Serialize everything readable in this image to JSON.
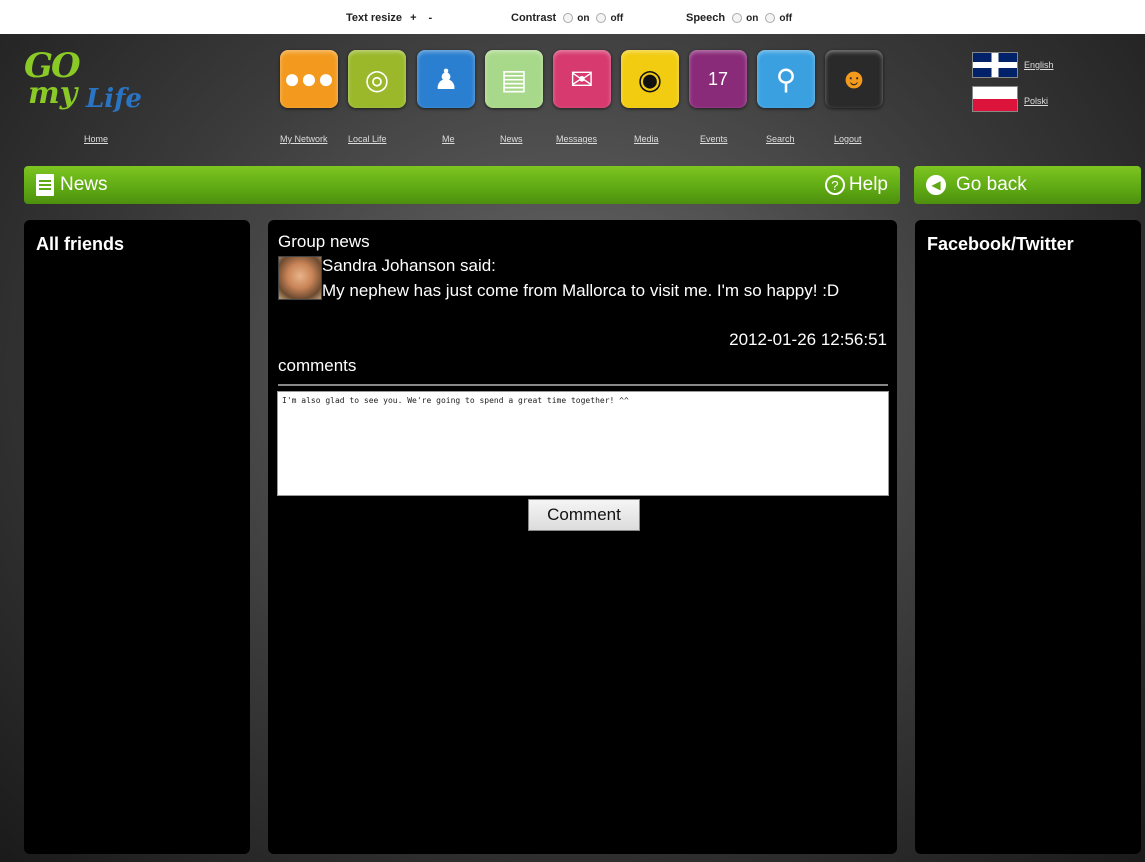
{
  "accessibility": {
    "text_resize_label": "Text resize",
    "text_increase": "+",
    "text_decrease": "-",
    "contrast_label": "Contrast",
    "speech_label": "Speech",
    "on": "on",
    "off": "off"
  },
  "header": {
    "logo_go": "GO",
    "logo_my": "my",
    "logo_life": "Life",
    "home_label": "Home",
    "nav": [
      {
        "label": "My Network",
        "icon": "network-icon",
        "color": "#f39a1e"
      },
      {
        "label": "Local Life",
        "icon": "local-life-icon",
        "color": "#9ab82a"
      },
      {
        "label": "Me",
        "icon": "user-icon",
        "color": "#2a7fd0"
      },
      {
        "label": "News",
        "icon": "news-icon",
        "color": "#a8d98a"
      },
      {
        "label": "Messages",
        "icon": "envelope-icon",
        "color": "#d63a6f"
      },
      {
        "label": "Media",
        "icon": "camera-icon",
        "color": "#f2cc10"
      },
      {
        "label": "Events",
        "icon": "calendar-icon",
        "color": "#8a2b7a"
      },
      {
        "label": "Search",
        "icon": "search-icon",
        "color": "#3aa0e0"
      },
      {
        "label": "Logout",
        "icon": "logout-icon",
        "color": "#2a2a2a"
      }
    ],
    "languages": [
      "English",
      "Polski"
    ]
  },
  "news_bar": {
    "title": "News",
    "help": "Help",
    "go_back": "Go back"
  },
  "left_panel": {
    "title": "All friends"
  },
  "right_panel": {
    "title": "Facebook/Twitter"
  },
  "center_panel": {
    "group_news": "Group news",
    "author_said": "Sandra Johanson said:",
    "post_text": "My nephew has just come from Mallorca to visit me. I'm so happy! :D",
    "timestamp": "2012-01-26 12:56:51",
    "comments_label": "comments",
    "comment_value": "I'm also glad to see you. We're going to spend a great time together! ^^",
    "comment_button": "Comment"
  }
}
